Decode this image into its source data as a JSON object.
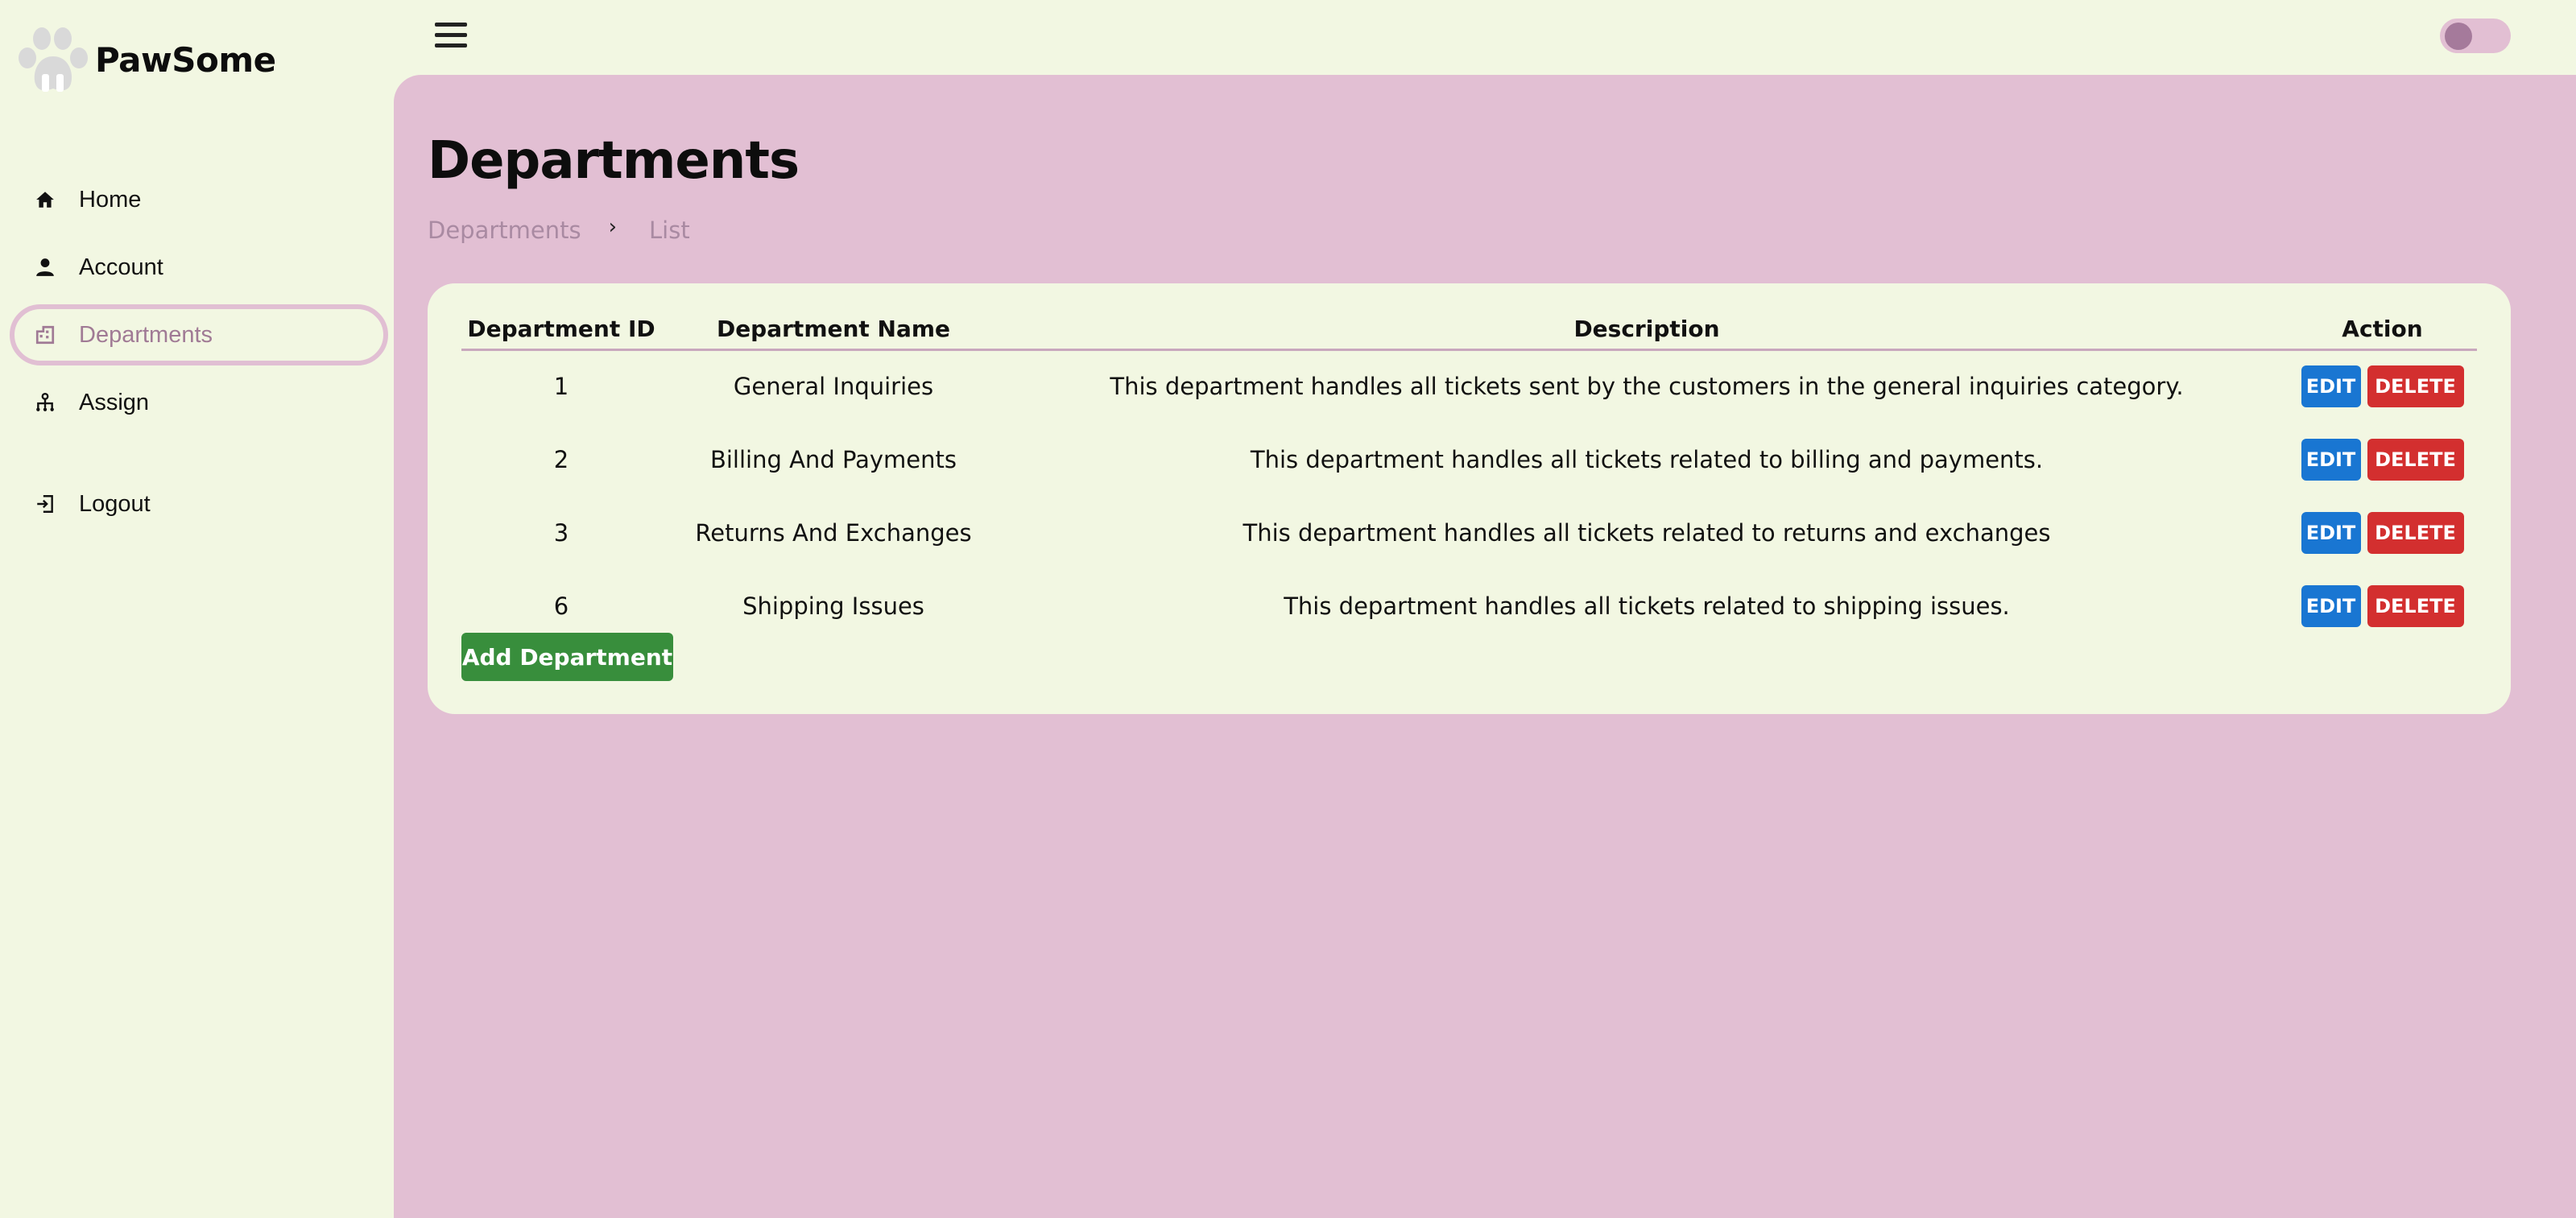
{
  "brand": {
    "name": "PawSome"
  },
  "sidebar": {
    "items": [
      {
        "label": "Home",
        "icon": "home-icon"
      },
      {
        "label": "Account",
        "icon": "person-icon"
      },
      {
        "label": "Departments",
        "icon": "building-icon",
        "active": true
      },
      {
        "label": "Assign",
        "icon": "hierarchy-icon"
      },
      {
        "label": "Logout",
        "icon": "logout-icon"
      }
    ]
  },
  "header": {
    "menu_icon": "hamburger-icon",
    "theme_toggle": "off"
  },
  "main": {
    "title": "Departments",
    "breadcrumb": [
      "Departments",
      "List"
    ],
    "table": {
      "columns": [
        "Department ID",
        "Department Name",
        "Description",
        "Action"
      ],
      "rows": [
        {
          "id": "1",
          "name": "General Inquiries",
          "description": "This department handles all tickets sent by the customers in the general inquiries category."
        },
        {
          "id": "2",
          "name": "Billing And Payments",
          "description": "This department handles all tickets related to billing and payments."
        },
        {
          "id": "3",
          "name": "Returns And Exchanges",
          "description": "This department handles all tickets related to returns and exchanges"
        },
        {
          "id": "6",
          "name": "Shipping Issues",
          "description": "This department handles all tickets related to shipping issues."
        }
      ],
      "edit_label": "EDIT",
      "delete_label": "DELETE"
    },
    "add_button": "Add Department"
  },
  "colors": {
    "sidebar_bg": "#f2f7e2",
    "main_bg": "#e2bfd3",
    "edit": "#1976d2",
    "delete": "#d32f2f",
    "add": "#388e3c"
  }
}
